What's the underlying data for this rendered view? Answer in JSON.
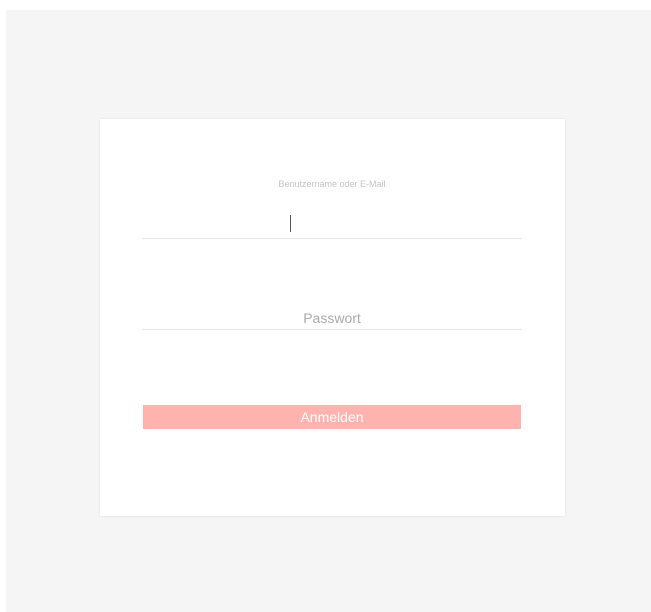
{
  "login": {
    "username_label": "Benutzername oder E-Mail",
    "username_value": "",
    "password_placeholder": "Passwort",
    "password_value": "",
    "submit_label": "Anmelden"
  },
  "colors": {
    "background": "#f5f5f5",
    "card": "#ffffff",
    "accent": "#ffb3ae"
  }
}
